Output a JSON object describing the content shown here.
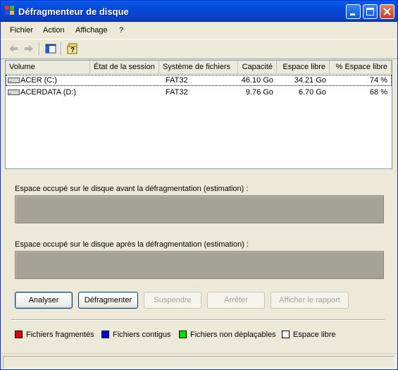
{
  "window": {
    "title": "Défragmenteur de disque"
  },
  "menu": {
    "items": [
      {
        "label": "Fichier"
      },
      {
        "label": "Action"
      },
      {
        "label": "Affichage"
      },
      {
        "label": "?"
      }
    ]
  },
  "toolbar": {
    "back_icon": "back-arrow-icon",
    "forward_icon": "forward-arrow-icon",
    "showhide_icon": "show-hide-console-tree-icon",
    "help_icon": "help-icon"
  },
  "volumes": {
    "columns": [
      "Volume",
      "État de la session",
      "Système de fichiers",
      "Capacité",
      "Espace libre",
      "% Espace libre"
    ],
    "rows": [
      {
        "volume": "ACER (C:)",
        "status": "",
        "fs": "FAT32",
        "capacity": "46.10 Go",
        "free": "34.21 Go",
        "pct": "74 %"
      },
      {
        "volume": "ACERDATA (D:)",
        "status": "",
        "fs": "FAT32",
        "capacity": "9.76 Go",
        "free": "6.70 Go",
        "pct": "68 %"
      }
    ]
  },
  "analysis": {
    "before_label": "Espace occupé sur le disque avant la défragmentation (estimation) :",
    "after_label": "Espace occupé sur le disque après la défragmentation (estimation) :"
  },
  "buttons": {
    "analyze": "Analyser",
    "defragment": "Défragmenter",
    "pause": "Suspendre",
    "stop": "Arrêter",
    "report": "Afficher le rapport"
  },
  "legend": [
    {
      "label": "Fichiers fragmentés",
      "color": "#e00000"
    },
    {
      "label": "Fichiers contigus",
      "color": "#0000e0"
    },
    {
      "label": "Fichiers non déplaçables",
      "color": "#00e000"
    },
    {
      "label": "Espace libre",
      "color": "#ffffff"
    }
  ]
}
